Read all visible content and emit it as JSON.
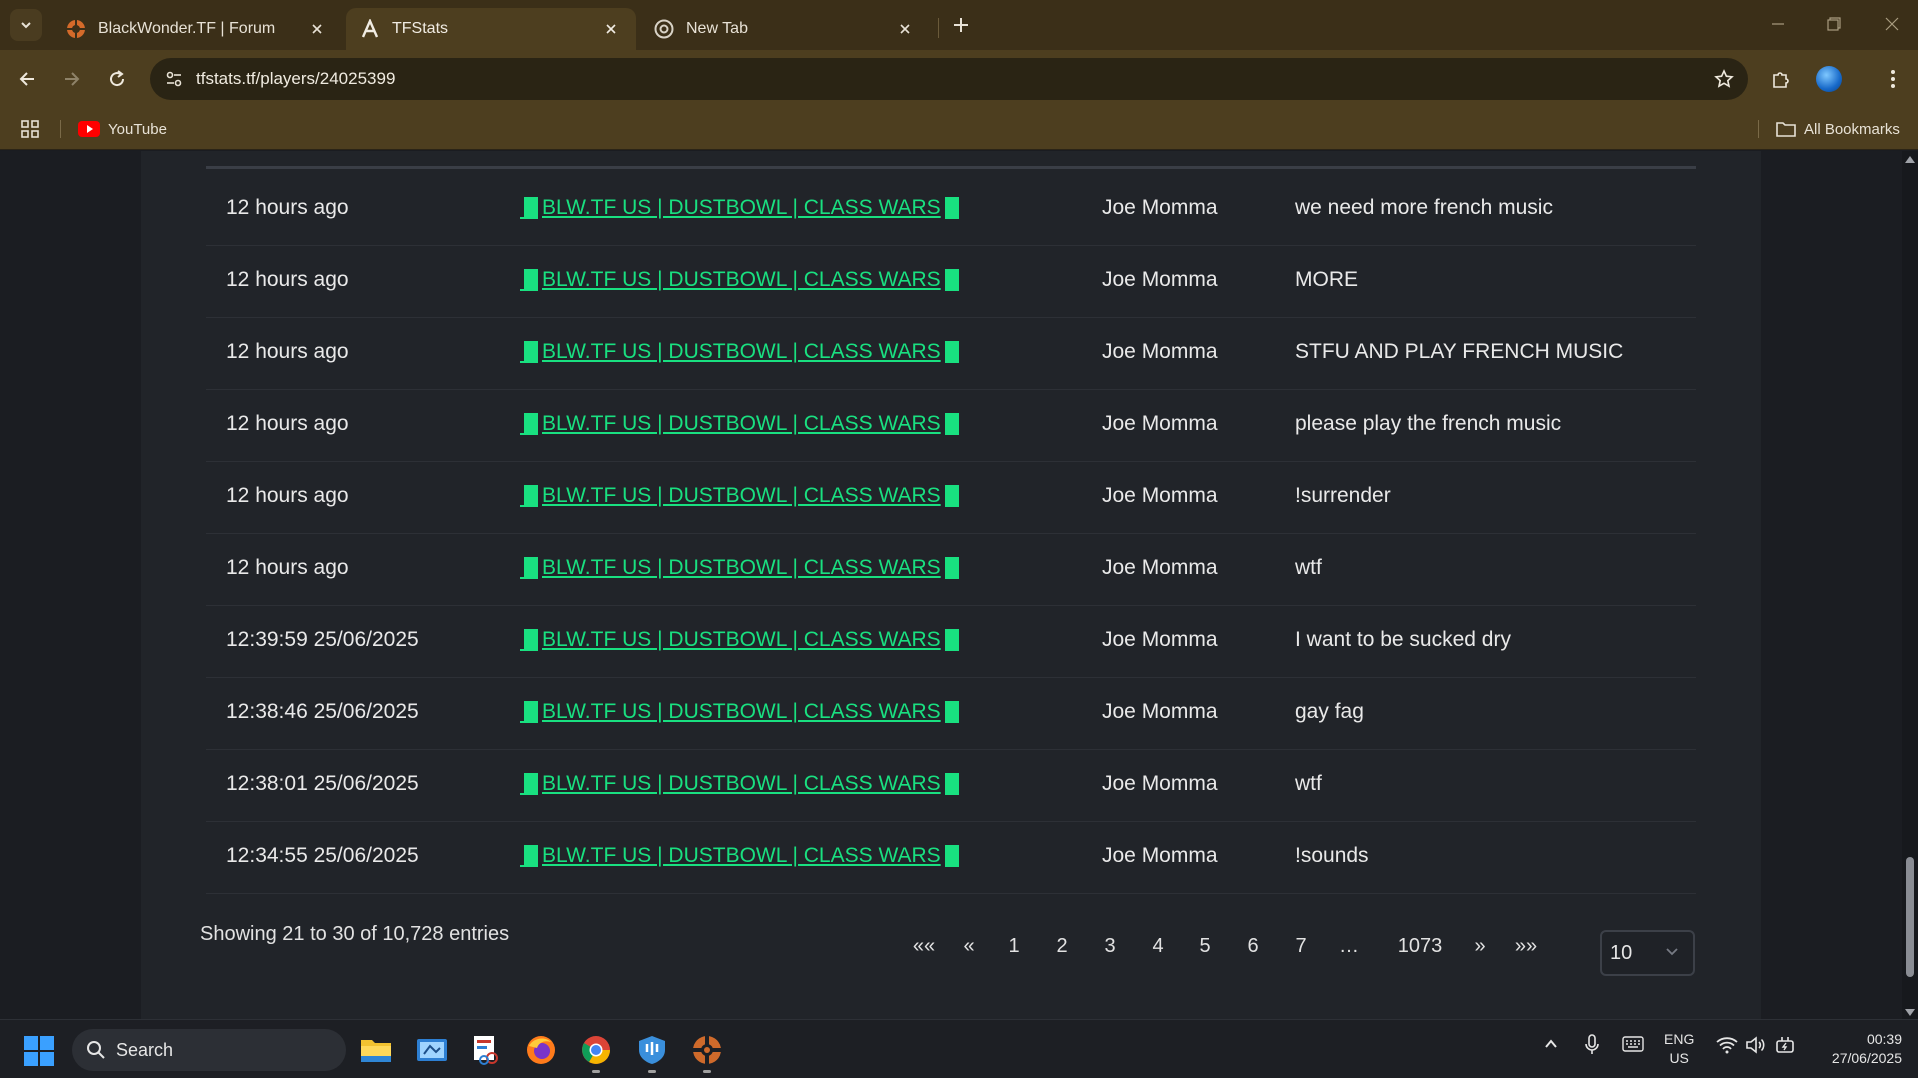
{
  "browser": {
    "tabs": [
      {
        "title": "BlackWonder.TF | Forum",
        "active": false
      },
      {
        "title": "TFStats",
        "active": true
      },
      {
        "title": "New Tab",
        "active": false
      }
    ],
    "url": "tfstats.tf/players/24025399",
    "bookmarks": {
      "youtube": "YouTube",
      "all": "All Bookmarks"
    }
  },
  "table": {
    "rows": [
      {
        "time": "12 hours ago",
        "server": "BLW.TF US | DUSTBOWL | CLASS WARS",
        "player": "Joe Momma",
        "message": "we need more french music"
      },
      {
        "time": "12 hours ago",
        "server": "BLW.TF US | DUSTBOWL | CLASS WARS",
        "player": "Joe Momma",
        "message": "MORE"
      },
      {
        "time": "12 hours ago",
        "server": "BLW.TF US | DUSTBOWL | CLASS WARS",
        "player": "Joe Momma",
        "message": "STFU AND PLAY FRENCH MUSIC"
      },
      {
        "time": "12 hours ago",
        "server": "BLW.TF US | DUSTBOWL | CLASS WARS",
        "player": "Joe Momma",
        "message": "please play the french music"
      },
      {
        "time": "12 hours ago",
        "server": "BLW.TF US | DUSTBOWL | CLASS WARS",
        "player": "Joe Momma",
        "message": "!surrender"
      },
      {
        "time": "12 hours ago",
        "server": "BLW.TF US | DUSTBOWL | CLASS WARS",
        "player": "Joe Momma",
        "message": "wtf"
      },
      {
        "time": "12:39:59 25/06/2025",
        "server": "BLW.TF US | DUSTBOWL | CLASS WARS",
        "player": "Joe Momma",
        "message": "I want to be sucked dry"
      },
      {
        "time": "12:38:46 25/06/2025",
        "server": "BLW.TF US | DUSTBOWL | CLASS WARS",
        "player": "Joe Momma",
        "message": "gay fag"
      },
      {
        "time": "12:38:01 25/06/2025",
        "server": "BLW.TF US | DUSTBOWL | CLASS WARS",
        "player": "Joe Momma",
        "message": "wtf"
      },
      {
        "time": "12:34:55 25/06/2025",
        "server": "BLW.TF US | DUSTBOWL | CLASS WARS",
        "player": "Joe Momma",
        "message": "!sounds"
      }
    ],
    "entries_info": "Showing 21 to 30 of 10,728 entries"
  },
  "pagination": {
    "first": "««",
    "prev": "«",
    "pages": [
      "1",
      "2",
      "3",
      "4",
      "5",
      "6",
      "7"
    ],
    "ellipsis": "…",
    "last_page": "1073",
    "next": "»",
    "last": "»»",
    "per_page": "10"
  },
  "taskbar": {
    "search_label": "Search",
    "lang_top": "ENG",
    "lang_bottom": "US",
    "time": "00:39",
    "date": "27/06/2025"
  }
}
